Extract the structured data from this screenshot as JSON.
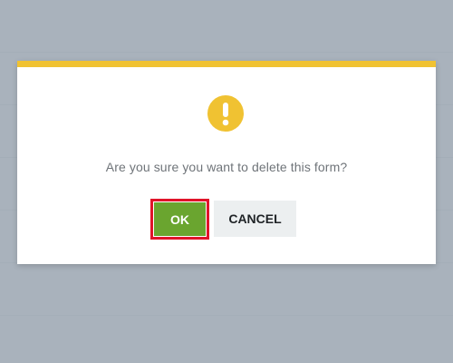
{
  "dialog": {
    "icon": "exclamation-icon",
    "message": "Are you sure you want to delete this form?",
    "ok_label": "OK",
    "cancel_label": "CANCEL"
  },
  "colors": {
    "accent_bar": "#f0c232",
    "warning_icon": "#f0c232",
    "ok_button": "#6aa52f",
    "focus_outline": "#e0142a",
    "cancel_button": "#eceff0",
    "overlay": "#a7b1bb"
  }
}
